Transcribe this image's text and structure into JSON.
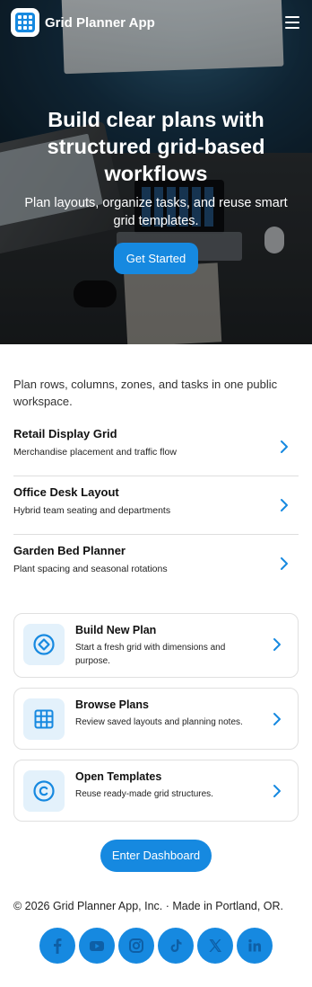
{
  "header": {
    "app_name": "Grid Planner App",
    "logo_icon": "grid-icon",
    "menu_icon": "hamburger-menu-icon"
  },
  "hero": {
    "title": "Build clear plans with structured grid-based workflows",
    "subtitle": "Plan layouts, organize tasks, and reuse smart grid templates.",
    "cta_label": "Get Started"
  },
  "intro": "Plan rows, columns, zones, and tasks in one public workspace.",
  "plans": [
    {
      "title": "Retail Display Grid",
      "desc": "Merchandise placement and traffic flow"
    },
    {
      "title": "Office Desk Layout",
      "desc": "Hybrid team seating and departments"
    },
    {
      "title": "Garden Bed Planner",
      "desc": "Plant spacing and seasonal rotations"
    }
  ],
  "actions": [
    {
      "title": "Build New Plan",
      "desc": "Start a fresh grid with dimensions and purpose.",
      "icon": "diamond-target-icon"
    },
    {
      "title": "Browse Plans",
      "desc": "Review saved layouts and planning notes.",
      "icon": "grid-icon"
    },
    {
      "title": "Open Templates",
      "desc": "Reuse ready-made grid structures.",
      "icon": "copyright-circle-icon"
    }
  ],
  "dashboard_label": "Enter Dashboard",
  "footer": {
    "copyright": "© 2026 Grid Planner App, Inc. · Made in Portland, OR.",
    "socials": [
      "facebook-icon",
      "youtube-icon",
      "instagram-icon",
      "tiktok-icon",
      "x-icon",
      "linkedin-icon"
    ]
  },
  "colors": {
    "accent": "#1689e0",
    "icon_bg": "#e3f1fb",
    "divider": "#dedede"
  }
}
